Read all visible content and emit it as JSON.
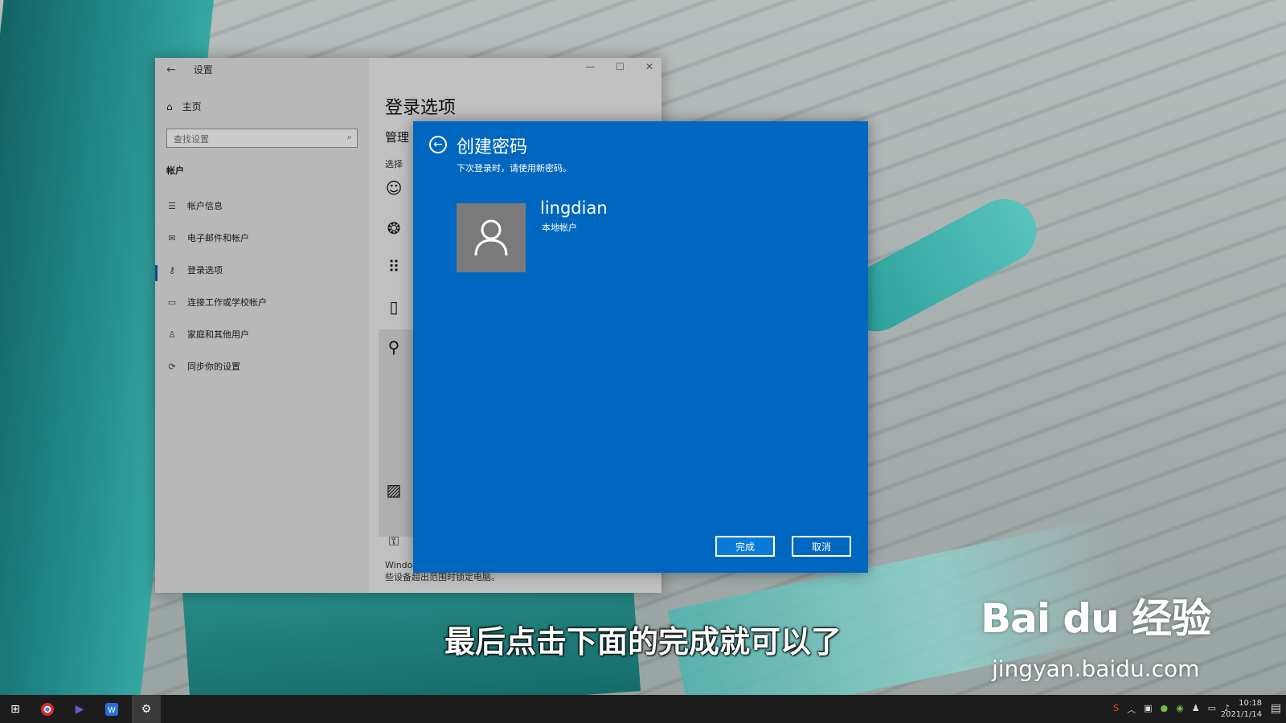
{
  "settings": {
    "title": "设置",
    "home": "主页",
    "search_placeholder": "查找设置",
    "group": "帐户",
    "nav": [
      {
        "label": "帐户信息",
        "icon": "person-list-icon"
      },
      {
        "label": "电子邮件和帐户",
        "icon": "mail-icon"
      },
      {
        "label": "登录选项",
        "icon": "key-icon"
      },
      {
        "label": "连接工作或学校帐户",
        "icon": "briefcase-icon"
      },
      {
        "label": "家庭和其他用户",
        "icon": "person-icon"
      },
      {
        "label": "同步你的设置",
        "icon": "sync-icon"
      }
    ],
    "active_nav": "登录选项",
    "content_title": "登录选项",
    "manage_label": "管理",
    "choose_label": "选择",
    "footer_text": "Windows 可以通过与你的电脑配对的设备获悉你何时离开，并在这些设备超出范围时锁定电脑。"
  },
  "dialog": {
    "title": "创建密码",
    "subtitle": "下次登录时，请使用新密码。",
    "username": "lingdian",
    "account_type": "本地帐户",
    "done_label": "完成",
    "cancel_label": "取消",
    "bg_color": "#0067c0"
  },
  "caption": "最后点击下面的完成就可以了",
  "watermark": {
    "brand": "Bai du 经验",
    "url": "jingyan.baidu.com"
  },
  "taskbar": {
    "time": "10:18",
    "date": "2021/1/14"
  }
}
